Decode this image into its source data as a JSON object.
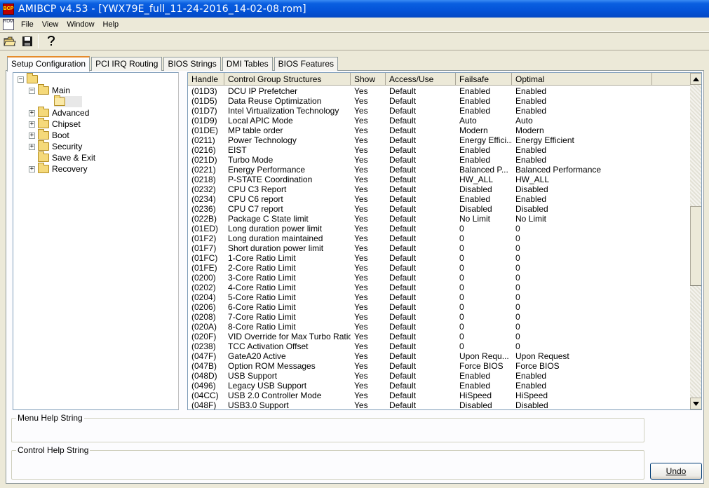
{
  "window": {
    "title": "AMIBCP v4.53 - [YWX79E_full_11-24-2016_14-02-08.rom]",
    "app_icon_text": "BCP",
    "doc_icon_text": "ROM"
  },
  "menu": [
    "File",
    "View",
    "Window",
    "Help"
  ],
  "toolbar": {
    "icons": [
      "open-folder-icon",
      "save-disk-icon",
      "help-question-icon"
    ]
  },
  "tabs": [
    {
      "label": "Setup Configuration",
      "active": true
    },
    {
      "label": "PCI IRQ Routing",
      "active": false
    },
    {
      "label": "BIOS Strings",
      "active": false
    },
    {
      "label": "DMI Tables",
      "active": false
    },
    {
      "label": "BIOS Features",
      "active": false
    }
  ],
  "tree": {
    "items": [
      {
        "label": "",
        "expander": "−"
      },
      {
        "label": "Main",
        "expander": "−"
      },
      {
        "label": "",
        "expander": ""
      },
      {
        "label": "Advanced",
        "expander": "+"
      },
      {
        "label": "Chipset",
        "expander": "+"
      },
      {
        "label": "Boot",
        "expander": "+"
      },
      {
        "label": "Security",
        "expander": "+"
      },
      {
        "label": "Save & Exit",
        "expander": ""
      },
      {
        "label": "Recovery",
        "expander": "+"
      }
    ]
  },
  "grid": {
    "columns": [
      "Handle",
      "Control Group Structures",
      "Show",
      "Access/Use",
      "Failsafe",
      "Optimal"
    ],
    "rows": [
      [
        "(01D3)",
        "DCU IP Prefetcher",
        "Yes",
        "Default",
        "Enabled",
        "Enabled"
      ],
      [
        "(01D5)",
        "Data Reuse Optimization",
        "Yes",
        "Default",
        "Enabled",
        "Enabled"
      ],
      [
        "(01D7)",
        "Intel Virtualization Technology",
        "Yes",
        "Default",
        "Enabled",
        "Enabled"
      ],
      [
        "(01D9)",
        "Local APIC Mode",
        "Yes",
        "Default",
        "Auto",
        "Auto"
      ],
      [
        "(01DE)",
        "MP table order",
        "Yes",
        "Default",
        "Modern",
        "Modern"
      ],
      [
        "(0211)",
        "Power Technology",
        "Yes",
        "Default",
        "Energy Effici...",
        "Energy Efficient"
      ],
      [
        "(0216)",
        "EIST",
        "Yes",
        "Default",
        "Enabled",
        "Enabled"
      ],
      [
        "(021D)",
        "Turbo Mode",
        "Yes",
        "Default",
        "Enabled",
        "Enabled"
      ],
      [
        "(0221)",
        "Energy Performance",
        "Yes",
        "Default",
        "Balanced P...",
        "Balanced Performance"
      ],
      [
        "(0218)",
        "P-STATE Coordination",
        "Yes",
        "Default",
        "HW_ALL",
        "HW_ALL"
      ],
      [
        "(0232)",
        "CPU C3 Report",
        "Yes",
        "Default",
        "Disabled",
        "Disabled"
      ],
      [
        "(0234)",
        "CPU C6 report",
        "Yes",
        "Default",
        "Enabled",
        "Enabled"
      ],
      [
        "(0236)",
        "CPU C7 report",
        "Yes",
        "Default",
        "Disabled",
        "Disabled"
      ],
      [
        "(022B)",
        "Package C State limit",
        "Yes",
        "Default",
        "No Limit",
        "No Limit"
      ],
      [
        "(01ED)",
        "Long duration power limit",
        "Yes",
        "Default",
        "0",
        "0"
      ],
      [
        "(01F2)",
        "Long duration maintained",
        "Yes",
        "Default",
        "0",
        "0"
      ],
      [
        "(01F7)",
        "Short duration power limit",
        "Yes",
        "Default",
        "0",
        "0"
      ],
      [
        "(01FC)",
        "1-Core Ratio Limit",
        "Yes",
        "Default",
        "0",
        "0"
      ],
      [
        "(01FE)",
        "2-Core Ratio Limit",
        "Yes",
        "Default",
        "0",
        "0"
      ],
      [
        "(0200)",
        "3-Core Ratio Limit",
        "Yes",
        "Default",
        "0",
        "0"
      ],
      [
        "(0202)",
        "4-Core Ratio Limit",
        "Yes",
        "Default",
        "0",
        "0"
      ],
      [
        "(0204)",
        "5-Core Ratio Limit",
        "Yes",
        "Default",
        "0",
        "0"
      ],
      [
        "(0206)",
        "6-Core Ratio Limit",
        "Yes",
        "Default",
        "0",
        "0"
      ],
      [
        "(0208)",
        "7-Core Ratio Limit",
        "Yes",
        "Default",
        "0",
        "0"
      ],
      [
        "(020A)",
        "8-Core Ratio Limit",
        "Yes",
        "Default",
        "0",
        "0"
      ],
      [
        "(020F)",
        "VID Override for Max Turbo Ratio",
        "Yes",
        "Default",
        "0",
        "0"
      ],
      [
        "(0238)",
        "TCC Activation Offset",
        "Yes",
        "Default",
        "0",
        "0"
      ],
      [
        "(047F)",
        "GateA20 Active",
        "Yes",
        "Default",
        "Upon Requ...",
        "Upon Request"
      ],
      [
        "(047B)",
        "Option ROM Messages",
        "Yes",
        "Default",
        "Force BIOS",
        "Force BIOS"
      ],
      [
        "(048D)",
        "USB Support",
        "Yes",
        "Default",
        "Enabled",
        "Enabled"
      ],
      [
        "(0496)",
        "Legacy USB Support",
        "Yes",
        "Default",
        "Enabled",
        "Enabled"
      ],
      [
        "(04CC)",
        "USB 2.0 Controller Mode",
        "Yes",
        "Default",
        "HiSpeed",
        "HiSpeed"
      ],
      [
        "(048F)",
        "USB3.0 Support",
        "Yes",
        "Default",
        "Disabled",
        "Disabled"
      ]
    ]
  },
  "help": {
    "menu_help_label": "Menu Help String",
    "control_help_label": "Control Help String"
  },
  "buttons": {
    "undo": "Undo"
  },
  "colors": {
    "titlebar": "#0453d8",
    "active_tab_accent": "#e68b2c",
    "window_bg": "#ece9d8"
  }
}
